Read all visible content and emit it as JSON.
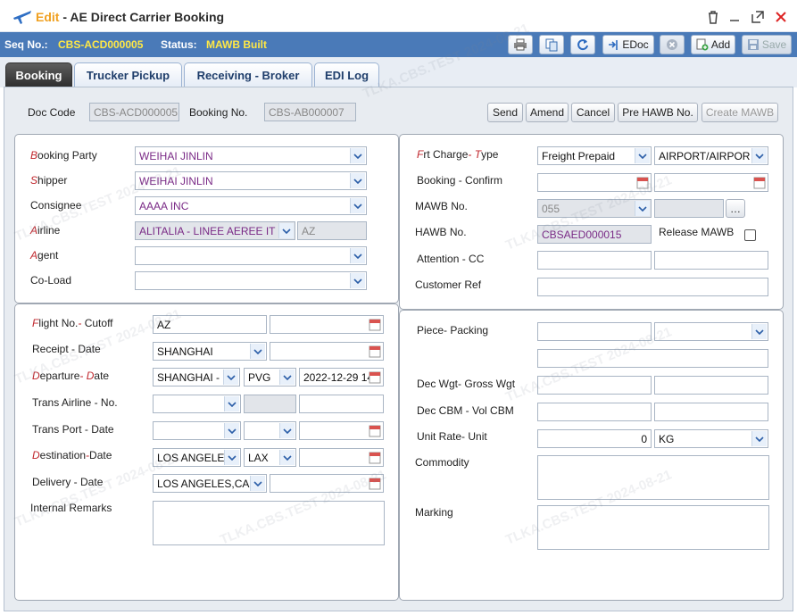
{
  "window": {
    "title_prefix": "Edit",
    "title_sep": " - ",
    "title": "AE Direct Carrier Booking"
  },
  "status": {
    "seq_label": "Seq No.:",
    "seq_value": "CBS-ACD000005",
    "status_label": "Status:",
    "status_value": "MAWB Built"
  },
  "toolbar": {
    "edoc": "EDoc",
    "add": "Add",
    "save": "Save"
  },
  "tabs": [
    "Booking",
    "Trucker Pickup",
    "Receiving - Broker",
    "EDI Log"
  ],
  "header": {
    "doc_code_label": "Doc Code",
    "doc_code": "CBS-ACD000005",
    "booking_no_label": "Booking No.",
    "booking_no": "CBS-AB000007",
    "buttons": [
      "Send",
      "Amend",
      "Cancel",
      "Pre HAWB No.",
      "Create MAWB"
    ]
  },
  "left_top": {
    "booking_party": {
      "first": "B",
      "rest": "ooking Party",
      "value": "WEIHAI JINLIN"
    },
    "shipper": {
      "first": "S",
      "rest": "hipper",
      "value": "WEIHAI JINLIN"
    },
    "consignee": {
      "label": "Consignee",
      "value": "AAAA INC"
    },
    "airline": {
      "first": "A",
      "rest": "irline",
      "value": "ALITALIA - LINEE AEREE IT",
      "code": "AZ"
    },
    "agent": {
      "first": "A",
      "rest": "gent",
      "value": ""
    },
    "coload": {
      "label": "Co-Load",
      "value": ""
    }
  },
  "left_bottom": {
    "flight": {
      "first": "F",
      "rest": "light No.",
      "sep": "- ",
      "second": "Cutoff",
      "value": "AZ"
    },
    "receipt": {
      "label": "Receipt",
      "sep": " - ",
      "second": "Date",
      "value": "SHANGHAI"
    },
    "departure": {
      "first": "D",
      "rest": "eparture",
      "sep": "- ",
      "second_first": "D",
      "second_rest": "ate",
      "city": "SHANGHAI -",
      "port": "PVG",
      "date": "2022-12-29 14:"
    },
    "trans_airline": {
      "label": "Trans Airline",
      "sep": " - ",
      "second": "No."
    },
    "trans_port": {
      "label": "Trans Port",
      "sep": " - ",
      "second": "Date"
    },
    "destination": {
      "first": "D",
      "rest": "estination",
      "sep": "-",
      "second": "Date",
      "city": "LOS ANGELE",
      "port": "LAX"
    },
    "delivery": {
      "label": "Delivery",
      "sep": " - ",
      "second": "Date",
      "value": "LOS ANGELES,CA"
    },
    "internal_remarks": {
      "label": "Internal Remarks"
    }
  },
  "right_top": {
    "frt": {
      "first": "F",
      "rest": "rt Charge",
      "sep": "- ",
      "second_first": "T",
      "second_rest": "ype",
      "value": "Freight Prepaid",
      "type": "AIRPORT/AIRPOR"
    },
    "booking": {
      "label": "Booking",
      "sep": " - ",
      "second": "Confirm"
    },
    "mawb": {
      "label": "MAWB No.",
      "value": "055"
    },
    "hawb": {
      "label": "HAWB No.",
      "value": "CBSAED000015",
      "release_label": "Release MAWB"
    },
    "attention": {
      "label": "Attention",
      "sep": " - ",
      "second": "CC"
    },
    "customer_ref": {
      "label": "Customer Ref"
    }
  },
  "right_bottom": {
    "piece": {
      "label": "Piece",
      "sep": "- ",
      "second": "Packing"
    },
    "dec_wgt": {
      "label": "Dec Wgt",
      "sep": "- ",
      "second": "Gross Wgt"
    },
    "dec_cbm": {
      "label": "Dec CBM",
      "sep": " - ",
      "second": "Vol CBM"
    },
    "unit_rate": {
      "label": "Unit Rate",
      "sep": "- ",
      "second": "Unit",
      "value": "0",
      "unit": "KG"
    },
    "commodity": {
      "label": "Commodity"
    },
    "marking": {
      "label": "Marking"
    }
  },
  "watermark": "TLKA.CBS.TEST 2024-08-21",
  "colors": {
    "status_bar": "#4a7ab8",
    "status_value": "#ffe845",
    "required": "#c0272d",
    "title_accent": "#f0a020"
  }
}
